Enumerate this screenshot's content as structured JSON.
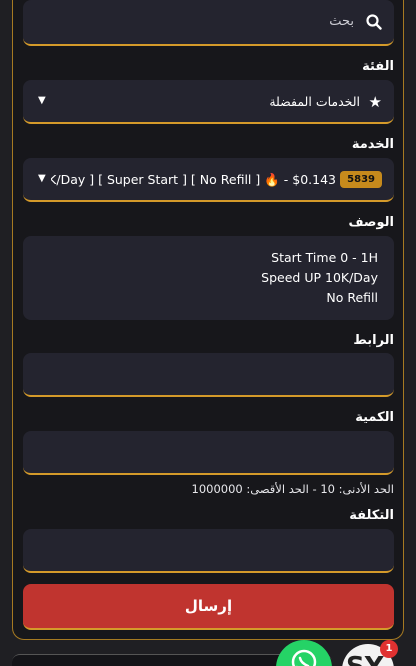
{
  "search": {
    "placeholder": "بحث",
    "icon": "search-icon"
  },
  "category": {
    "label": "الفئة",
    "selected": "الخدمات المفضلة",
    "icon": "star-icon"
  },
  "service": {
    "label": "الخدمة",
    "id_badge": "5839",
    "selected": "$0.143 - 🔥 [ No Refill ] [ Super Start ] [ K/Day…"
  },
  "description": {
    "label": "الوصف",
    "lines": [
      "Start Time 0 - 1H",
      "Speed UP 10K/Day",
      "No Refill"
    ]
  },
  "link": {
    "label": "الرابط",
    "value": ""
  },
  "quantity": {
    "label": "الكمية",
    "value": "",
    "limits_text": "الحد الأدنى: 10 - الحد الأقصى: 1000000"
  },
  "cost": {
    "label": "التكلفة",
    "value": ""
  },
  "submit": {
    "label": "إرسال"
  },
  "floating": {
    "notification_count": "1",
    "whatsapp_icon": "whatsapp-icon"
  },
  "colors": {
    "accent": "#d49a2a",
    "submit": "#c0342f",
    "field_bg": "#24242f",
    "badge": "#c68a1c"
  }
}
